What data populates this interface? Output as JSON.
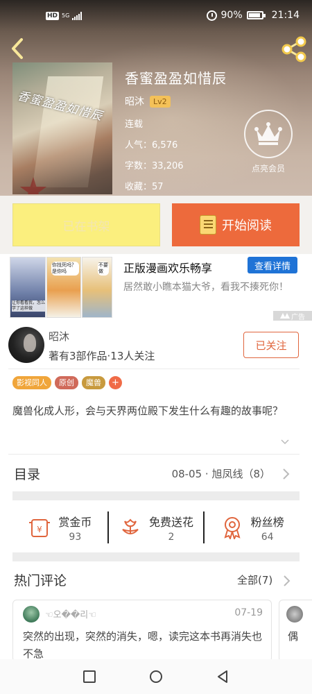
{
  "status_bar": {
    "hd": "HD",
    "network": "5G",
    "battery": "90%",
    "time": "21:14"
  },
  "book": {
    "title": "香蜜盈盈如惜辰",
    "cover_text": "香蜜盈盈如惜辰",
    "author": "昭沐",
    "level": "Lv2",
    "status": "连载",
    "popularity_label": "人气：",
    "popularity": "6,576",
    "word_count_label": "字数：",
    "word_count": "33,206",
    "favorites_label": "收藏：",
    "favorites": "57"
  },
  "vip": {
    "label": "点亮会员",
    "icon": "crown-icon"
  },
  "actions": {
    "add_shelf": "已在书架",
    "start_reading": "开始阅读"
  },
  "ad": {
    "title": "正版漫画欢乐畅享",
    "detail_button": "查看详情",
    "description": "居然敢小瞧本猫大爷，看我不揍死你！",
    "ad_label": "广告",
    "thumb1_text": "让你看看我，怎么学了这样做",
    "thumb2_text": "你找死吗？是你吗",
    "thumb3_text": "不要做"
  },
  "author_card": {
    "name": "昭沐",
    "stats": "著有3部作品·13人关注",
    "follow": "已关注"
  },
  "tags": [
    {
      "label": "影视同人",
      "color": "#f0a53a"
    },
    {
      "label": "原创",
      "color": "#d06a5a"
    },
    {
      "label": "魔兽",
      "color": "#c89a3e"
    }
  ],
  "tag_add": "+",
  "intro": "魔兽化成人形，会与天界两位殿下发生什么有趣的故事呢？",
  "catalog": {
    "title": "目录",
    "latest": "08-05 · 旭凤线（8）"
  },
  "stats": [
    {
      "label": "赏金币",
      "value": "93",
      "icon": "reward-coin-icon"
    },
    {
      "label": "免费送花",
      "value": "2",
      "icon": "flower-icon"
    },
    {
      "label": "粉丝榜",
      "value": "64",
      "icon": "medal-icon"
    }
  ],
  "comments": {
    "title": "热门评论",
    "all": "全部(7)",
    "items": [
      {
        "user": "☜오��리☜",
        "date": "07-19",
        "body": "突然的出现，突然的消失，嗯，读完这本书再消失也不急"
      },
      {
        "user": "",
        "date": "",
        "body": "偶"
      }
    ]
  },
  "colors": {
    "accent": "#ed6a3c",
    "shelf_button": "#fbef7e",
    "link_blue": "#1f73d6",
    "level_badge": "#f4c158"
  }
}
